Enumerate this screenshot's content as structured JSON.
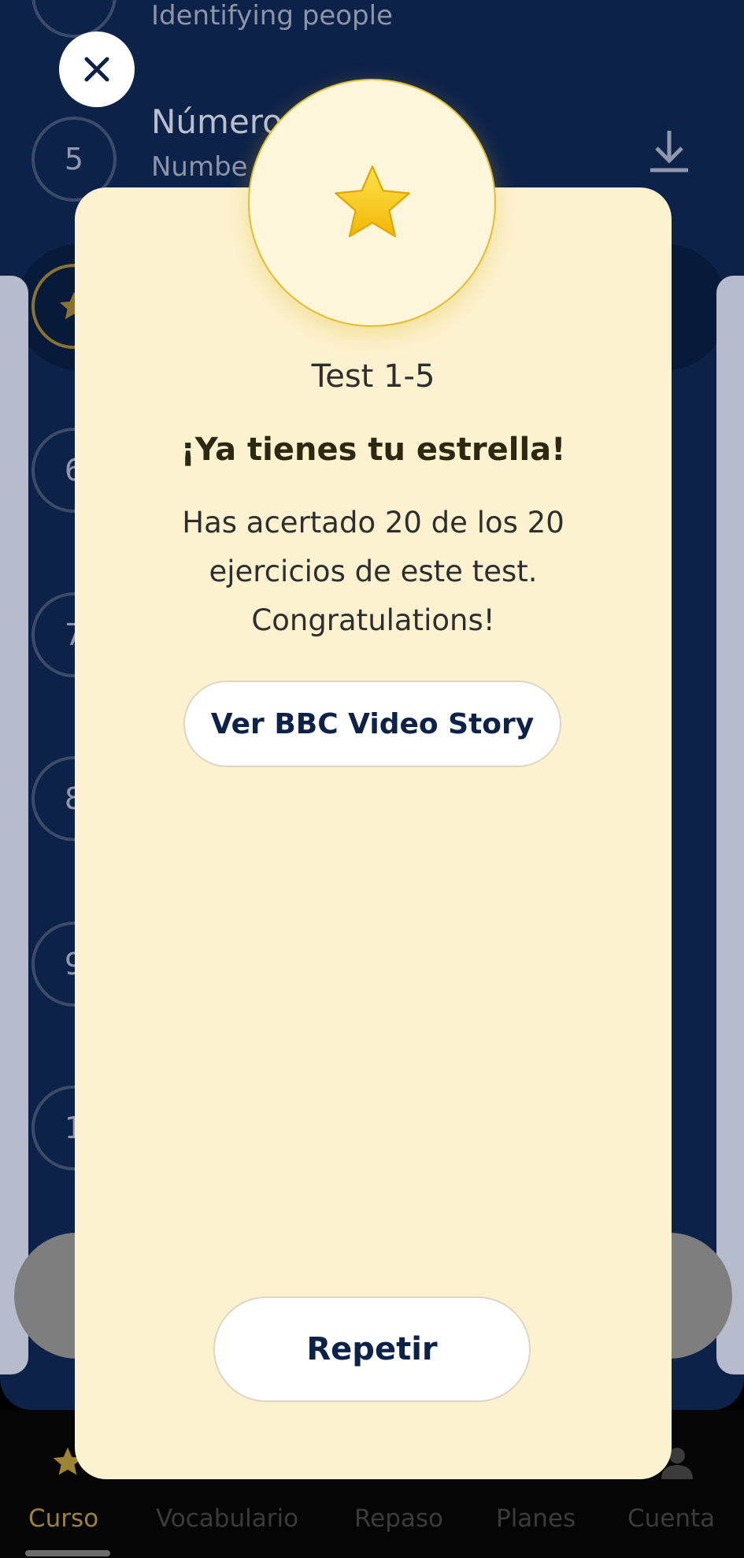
{
  "background": {
    "rows": [
      {
        "number": "",
        "title": "",
        "subtitle": "Identifying people"
      },
      {
        "number": "5",
        "title": "Número",
        "subtitle": "Numbe"
      },
      {
        "number": "",
        "title": "",
        "subtitle": ""
      },
      {
        "number": "6",
        "title": "",
        "subtitle": ""
      },
      {
        "number": "7",
        "title": "",
        "subtitle": ""
      },
      {
        "number": "8",
        "title": "",
        "subtitle": ""
      },
      {
        "number": "9",
        "title": "",
        "subtitle": ""
      },
      {
        "number": "1",
        "title": "",
        "subtitle": ""
      }
    ]
  },
  "close_icon": "close-icon",
  "modal": {
    "badge_icon": "star-icon",
    "subtitle": "Test 1-5",
    "title": "¡Ya tienes tu estrella!",
    "body": "Has acertado 20 de los 20 ejercicios de este test. Congratulations!",
    "video_button": "Ver BBC Video Story",
    "repeat_button": "Repetir"
  },
  "nav": {
    "items": [
      {
        "label": "Curso",
        "active": true
      },
      {
        "label": "Vocabulario",
        "active": false
      },
      {
        "label": "Repaso",
        "active": false
      },
      {
        "label": "Planes",
        "active": false
      },
      {
        "label": "Cuenta",
        "active": false
      }
    ]
  },
  "colors": {
    "navy": "#0d2249",
    "modal_bg": "#fcf2d0",
    "star": "#f5c518",
    "active_nav": "#9c8434"
  }
}
